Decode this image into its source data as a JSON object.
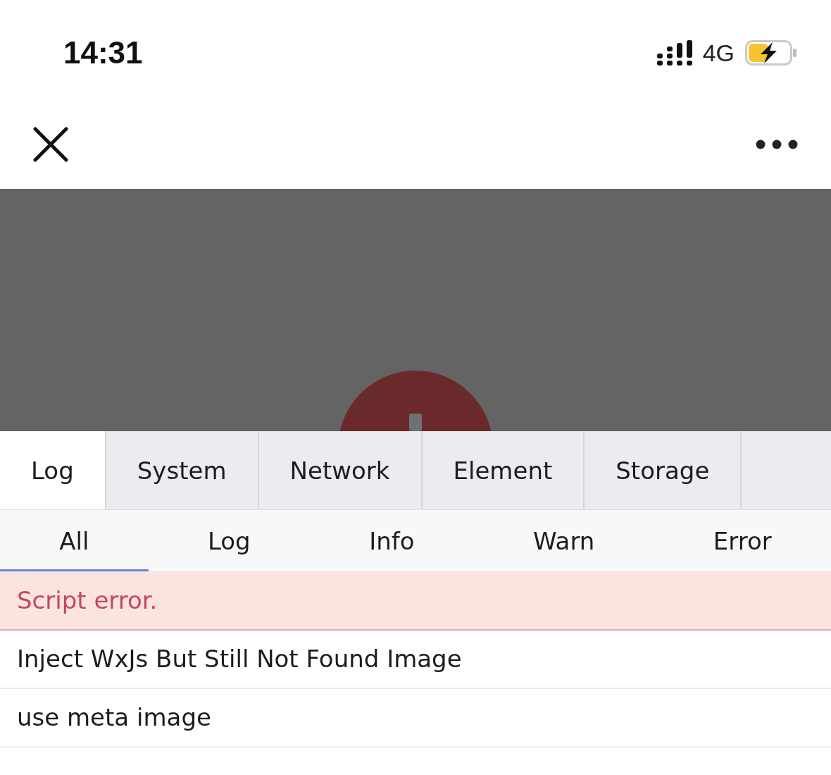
{
  "status_bar": {
    "time": "14:31",
    "network": "4G"
  },
  "tabs": [
    {
      "label": "Log",
      "selected": true
    },
    {
      "label": "System",
      "selected": false
    },
    {
      "label": "Network",
      "selected": false
    },
    {
      "label": "Element",
      "selected": false
    },
    {
      "label": "Storage",
      "selected": false
    }
  ],
  "filters": [
    {
      "label": "All",
      "selected": true
    },
    {
      "label": "Log",
      "selected": false
    },
    {
      "label": "Info",
      "selected": false
    },
    {
      "label": "Warn",
      "selected": false
    },
    {
      "label": "Error",
      "selected": false
    }
  ],
  "log_entries": [
    {
      "kind": "error",
      "text": "Script error."
    },
    {
      "kind": "log",
      "text": "Inject WxJs But Still Not Found Image"
    },
    {
      "kind": "log",
      "text": "use meta image"
    }
  ]
}
